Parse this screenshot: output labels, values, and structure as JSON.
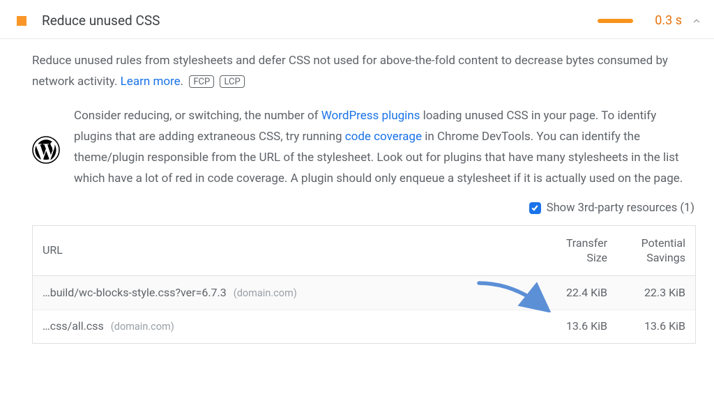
{
  "header": {
    "title": "Reduce unused CSS",
    "timing": "0.3 s"
  },
  "description": {
    "text_a": "Reduce unused rules from stylesheets and defer CSS not used for above-the-fold content to decrease bytes consumed by network activity. ",
    "learn_more": "Learn more",
    "period": ".",
    "tags": {
      "fcp": "FCP",
      "lcp": "LCP"
    }
  },
  "wp": {
    "a": "Consider reducing, or switching, the number of ",
    "link1": "WordPress plugins",
    "b": " loading unused CSS in your page. To identify plugins that are adding extraneous CSS, try running ",
    "link2": "code coverage",
    "c": " in Chrome DevTools. You can identify the theme/plugin responsible from the URL of the stylesheet. Look out for plugins that have many stylesheets in the list which have a lot of red in code coverage. A plugin should only enqueue a stylesheet if it is actually used on the page."
  },
  "toggle": {
    "label": "Show 3rd-party resources (1)"
  },
  "table": {
    "headers": {
      "url": "URL",
      "transfer_a": "Transfer",
      "transfer_b": "Size",
      "savings_a": "Potential",
      "savings_b": "Savings"
    },
    "rows": [
      {
        "url": "…build/wc-blocks-style.css?ver=6.7.3",
        "domain": "(domain.com)",
        "transfer": "22.4 KiB",
        "savings": "22.3 KiB"
      },
      {
        "url": "…css/all.css",
        "domain": "(domain.com)",
        "transfer": "13.6 KiB",
        "savings": "13.6 KiB"
      }
    ]
  }
}
